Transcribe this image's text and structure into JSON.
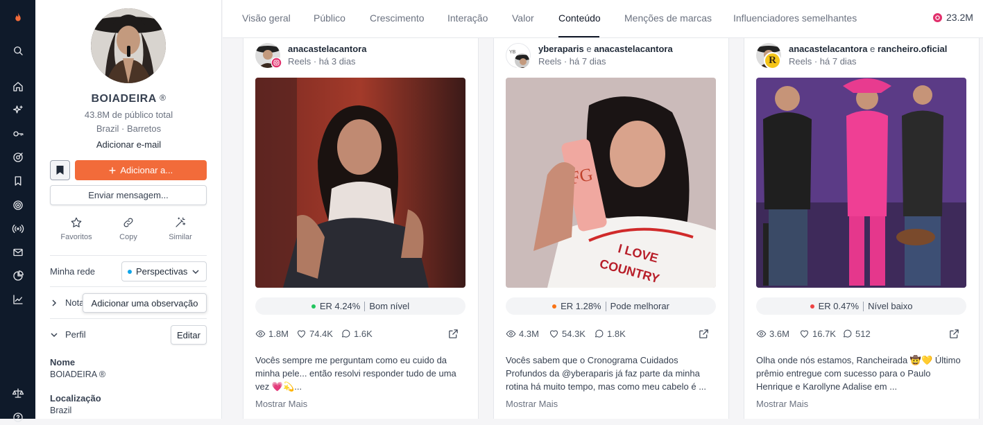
{
  "rail_icons": [
    "flame-logo",
    "search",
    "home",
    "sparkles",
    "key",
    "target-check",
    "bookmark",
    "radar",
    "broadcast",
    "mail",
    "pie-chart",
    "trend-chart",
    "scale",
    "help"
  ],
  "profile": {
    "name": "BOIADEIRA",
    "reg": "®",
    "audience": "43.8M de público total",
    "location": "Brazil · Barretos",
    "add_email": "Adicionar e-mail",
    "add_button": "Adicionar a...",
    "message_button": "Enviar mensagem...",
    "actions": [
      {
        "label": "Favoritos",
        "icon": "star-icon"
      },
      {
        "label": "Copy",
        "icon": "link-icon"
      },
      {
        "label": "Similar",
        "icon": "magic-wand-icon"
      }
    ],
    "network_label": "Minha rede",
    "network_select": "Perspectivas",
    "notes_label": "Notas",
    "notes_tooltip": "Adicionar uma observação",
    "profile_label": "Perfil",
    "edit_button": "Editar",
    "name_label": "Nome",
    "name_value": "BOIADEIRA ®",
    "location_label": "Localização",
    "location_value": "Brazil"
  },
  "tabs": [
    "Visão geral",
    "Público",
    "Crescimento",
    "Interação",
    "Valor",
    "Conteúdo",
    "Menções de marcas",
    "Influenciadores semelhantes"
  ],
  "active_tab": "Conteúdo",
  "follower_count": "23.2M",
  "posts": [
    {
      "handle1": "anacastelacantora",
      "joiner": "",
      "handle2": "",
      "meta": "Reels · há 3 dias",
      "er": "ER 4.24%",
      "er_level": "Bom nível",
      "er_color": "#22c55e",
      "views": "1.8M",
      "likes": "74.4K",
      "comments": "1.6K",
      "caption": "Vocês sempre me perguntam como eu cuido da minha pele... então resolvi responder tudo de uma vez 💗💫...",
      "more": "Mostrar Mais"
    },
    {
      "handle1": "yberaparis",
      "joiner": "e",
      "handle2": "anacastelacantora",
      "meta": "Reels · há 7 dias",
      "er": "ER 1.28%",
      "er_level": "Pode melhorar",
      "er_color": "#f97316",
      "views": "4.3M",
      "likes": "54.3K",
      "comments": "1.8K",
      "caption": "Vocês sabem que o Cronograma Cuidados Profundos da @yberaparis já faz parte da minha rotina há muito tempo, mas como meu cabelo é ...",
      "more": "Mostrar Mais"
    },
    {
      "handle1": "anacastelacantora",
      "joiner": "e",
      "handle2": "rancheiro.oficial",
      "meta": "Reels · há 7 dias",
      "er": "ER 0.47%",
      "er_level": "Nível baixo",
      "er_color": "#ef4444",
      "views": "3.6M",
      "likes": "16.7K",
      "comments": "512",
      "caption": "Olha onde nós estamos, Rancheirada 🤠💛 Último prêmio entregue com sucesso para o Paulo Henrique e Karollyne Adalise em ...",
      "more": "Mostrar Mais"
    }
  ]
}
